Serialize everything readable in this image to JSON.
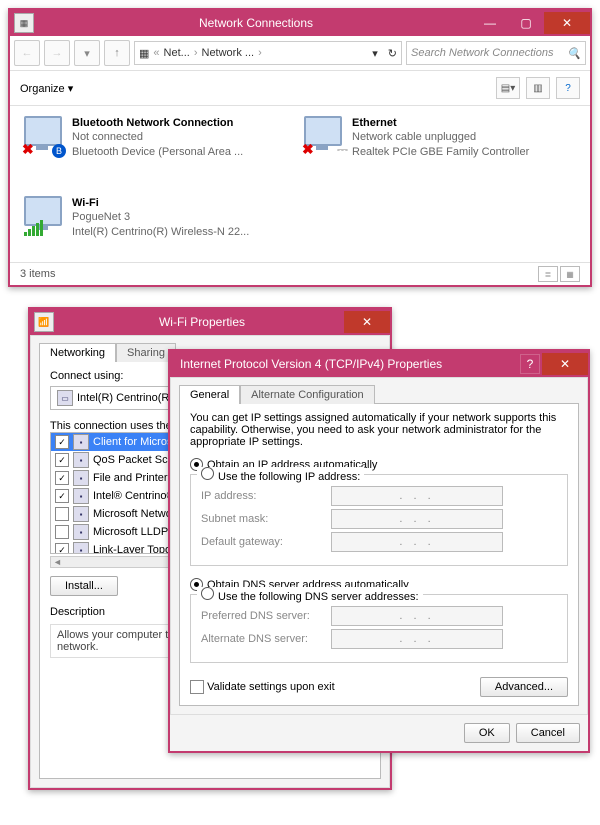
{
  "netwin": {
    "title": "Network Connections",
    "breadcrumb": {
      "b1": "Net...",
      "b2": "Network ..."
    },
    "search_placeholder": "Search Network Connections",
    "organize": "Organize",
    "items_text": "3 items",
    "conns": [
      {
        "name": "Bluetooth Network Connection",
        "status": "Not connected",
        "device": "Bluetooth Device (Personal Area ..."
      },
      {
        "name": "Ethernet",
        "status": "Network cable unplugged",
        "device": "Realtek PCIe GBE Family Controller"
      },
      {
        "name": "Wi-Fi",
        "status": "PogueNet 3",
        "device": "Intel(R) Centrino(R) Wireless-N 22..."
      }
    ]
  },
  "wifiprops": {
    "title": "Wi-Fi Properties",
    "tabs": {
      "networking": "Networking",
      "sharing": "Sharing"
    },
    "connect_using": "Connect using:",
    "adapter": "Intel(R) Centrino(R",
    "uses_label": "This connection uses the",
    "items": [
      {
        "c": true,
        "sel": true,
        "t": "Client for Micros"
      },
      {
        "c": true,
        "t": "QoS Packet Sc"
      },
      {
        "c": true,
        "t": "File and Printer"
      },
      {
        "c": true,
        "t": "Intel® Centrino®"
      },
      {
        "c": false,
        "t": "Microsoft Netwo"
      },
      {
        "c": false,
        "t": "Microsoft LLDP"
      },
      {
        "c": true,
        "t": "Link-Layer Topo"
      }
    ],
    "install": "Install...",
    "desc_h": "Description",
    "desc": "Allows your computer t\nnetwork."
  },
  "ipv4": {
    "title": "Internet Protocol Version 4 (TCP/IPv4) Properties",
    "tabs": {
      "general": "General",
      "alt": "Alternate Configuration"
    },
    "intro": "You can get IP settings assigned automatically if your network supports this capability. Otherwise, you need to ask your network administrator for the appropriate IP settings.",
    "r_auto_ip": "Obtain an IP address automatically",
    "r_use_ip": "Use the following IP address:",
    "ip": "IP address:",
    "mask": "Subnet mask:",
    "gw": "Default gateway:",
    "r_auto_dns": "Obtain DNS server address automatically",
    "r_use_dns": "Use the following DNS server addresses:",
    "pdns": "Preferred DNS server:",
    "adns": "Alternate DNS server:",
    "validate": "Validate settings upon exit",
    "advanced": "Advanced...",
    "ok": "OK",
    "cancel": "Cancel",
    "dots": ".     .     ."
  }
}
